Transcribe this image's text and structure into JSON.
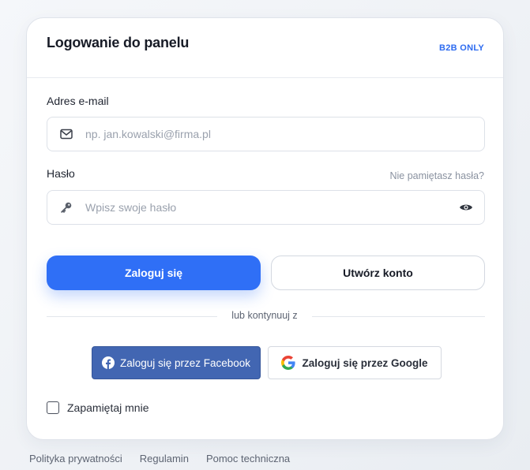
{
  "card": {
    "title": "Logowanie do panelu",
    "badge": "B2B ONLY"
  },
  "email": {
    "label": "Adres e-mail",
    "placeholder": "np. jan.kowalski@firma.pl",
    "value": "",
    "icon": "mail-icon"
  },
  "password": {
    "label": "Hasło",
    "placeholder": "Wpisz swoje hasło",
    "value": "",
    "icon": "key-icon",
    "forgot": "Nie pamiętasz hasła?"
  },
  "buttons": {
    "login": "Zaloguj się",
    "create": "Utwórz konto"
  },
  "divider": "lub kontynuuj z",
  "social": {
    "facebook": "Zaloguj się przez Facebook",
    "google": "Zaloguj się przez Google"
  },
  "remember": {
    "label": "Zapamiętaj mnie",
    "checked": false
  },
  "footer": {
    "links": [
      "Polityka prywatności",
      "Regulamin",
      "Pomoc techniczna"
    ]
  },
  "colors": {
    "primary": "#2f6ff6",
    "facebook": "#4266b2",
    "badge": "#2d6bf0"
  }
}
